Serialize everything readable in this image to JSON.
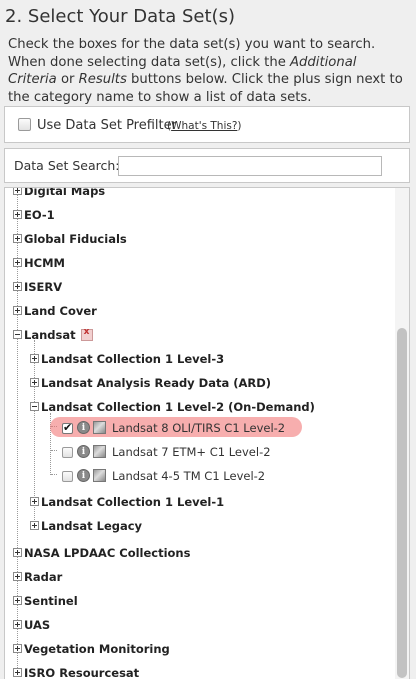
{
  "header": {
    "title": "2. Select Your Data Set(s)",
    "instr_1": "Check the boxes for the data set(s) you want to search. When done selecting data set(s), click the ",
    "instr_em1": "Additional Criteria",
    "instr_2": " or ",
    "instr_em2": "Results",
    "instr_3": " buttons below. Click the plus sign next to the category name to show a list of data sets."
  },
  "prefilter": {
    "label": "Use Data Set Prefilter",
    "link_open": "(",
    "link_text": "What's This?",
    "link_close": ")"
  },
  "search": {
    "label": "Data Set Search:",
    "value": ""
  },
  "tree": {
    "categories": [
      "Digital Maps",
      "EO-1",
      "Global Fiducials",
      "HCMM",
      "ISERV",
      "Land Cover",
      "Landsat",
      "NASA LPDAAC Collections",
      "Radar",
      "Sentinel",
      "UAS",
      "Vegetation Monitoring",
      "ISRO Resourcesat"
    ],
    "landsat_children": [
      "Landsat Collection 1 Level-3",
      "Landsat Analysis Ready Data (ARD)",
      "Landsat Collection 1 Level-2 (On-Demand)",
      "Landsat Collection 1 Level-1",
      "Landsat Legacy"
    ],
    "datasets": [
      {
        "label": "Landsat 8 OLI/TIRS C1 Level-2",
        "checked": true
      },
      {
        "label": "Landsat 7 ETM+ C1 Level-2",
        "checked": false
      },
      {
        "label": "Landsat 4-5 TM C1 Level-2",
        "checked": false
      }
    ],
    "info_icon": "info-icon",
    "map_icon": "map-preview-icon"
  },
  "colors": {
    "highlight": "#f27878",
    "background": "#efefef"
  }
}
